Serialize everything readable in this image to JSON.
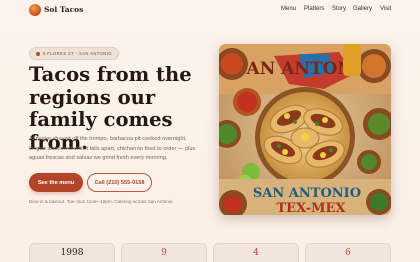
{
  "header": {
    "brand": "Sol Tacos",
    "nav": [
      "Menu",
      "Platters",
      "Story",
      "Gallery",
      "Visit"
    ]
  },
  "hero": {
    "location_pill": "5 FLORES ST · SAN ANTONIO",
    "headline": "Tacos from the regions our family comes from.",
    "lede": "Al pastor shaved off the trompo, barbacoa pit-cooked overnight, lengua simmered until it falls apart, chicharrón fried to order — plus aguas frescas and salsas we grind fresh every morning.",
    "primary_cta": "See the menu",
    "secondary_cta": "Call (210) 555-0158",
    "hours": "Dine-in & takeout. Tue–Sun 11am–10pm. Catering across San Antonio.",
    "image_text_top": "SAN ANTONIO",
    "image_text_bottom_1": "SAN ANTONIO",
    "image_text_bottom_2": "TEX-MEX"
  },
  "stats": [
    "1998",
    "9",
    "4",
    "6"
  ],
  "colors": {
    "accent": "#b2442a",
    "background": "#fbf3ec",
    "text": "#2a1d17"
  }
}
